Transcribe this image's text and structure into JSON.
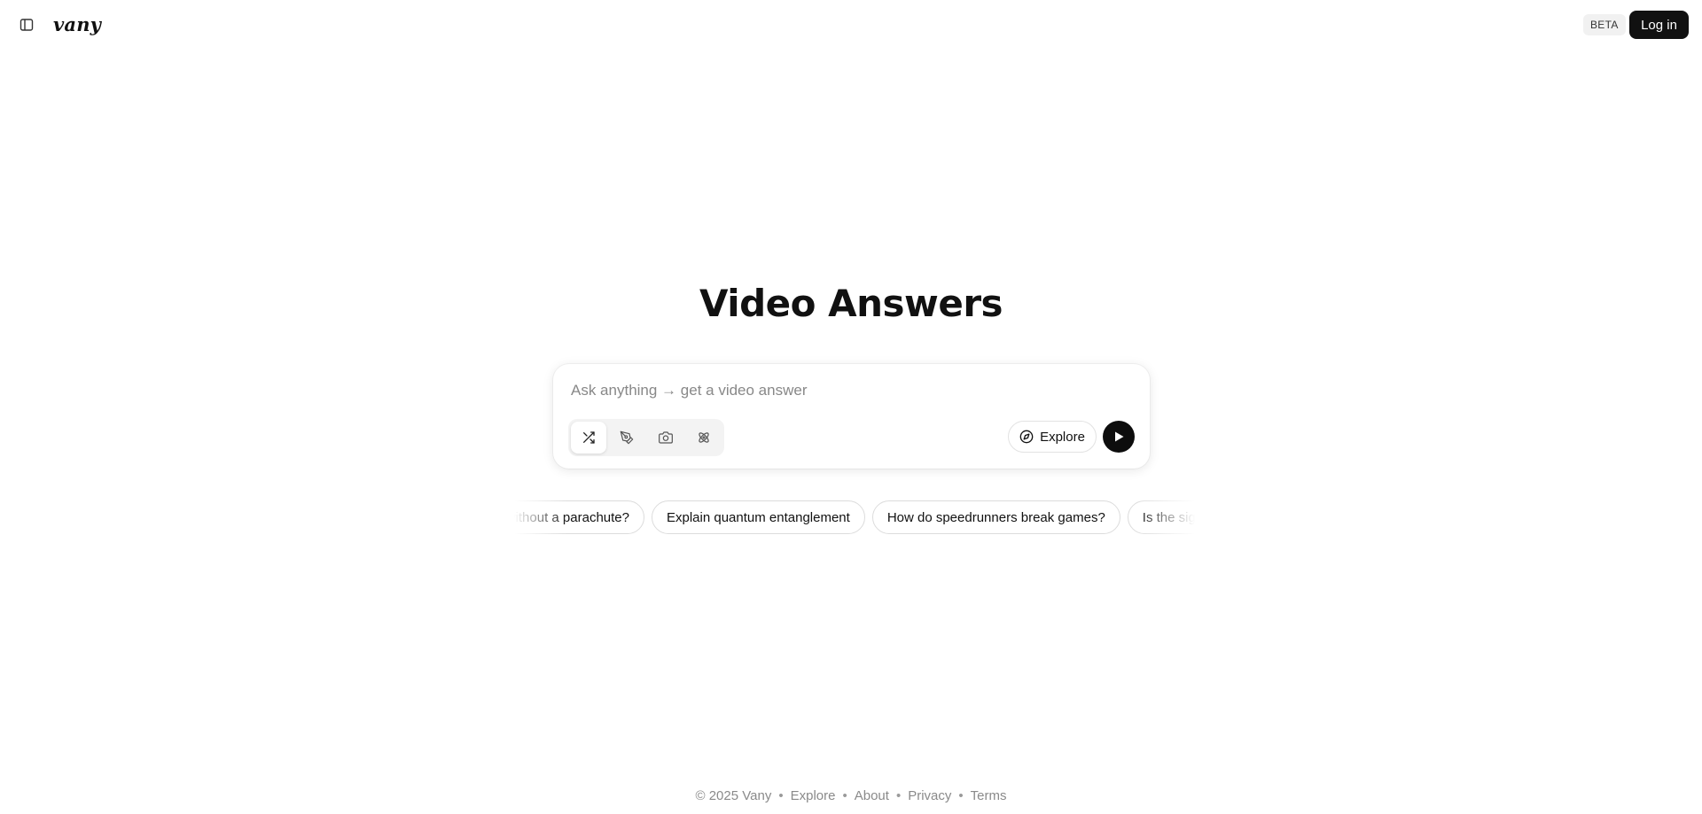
{
  "header": {
    "logo": "vany",
    "beta_badge": "BETA",
    "login_label": "Log in"
  },
  "hero": {
    "title": "Video Answers"
  },
  "composer": {
    "placeholder": "Ask anything → get a video answer",
    "modes": [
      {
        "icon": "shuffle-icon",
        "active": true
      },
      {
        "icon": "pen-tool-icon",
        "active": false
      },
      {
        "icon": "camera-icon",
        "active": false
      },
      {
        "icon": "atom-icon",
        "active": false
      }
    ],
    "explore_label": "Explore",
    "send_icon": "play-icon"
  },
  "suggestions": [
    "How do you survive a fall without a parachute?",
    "Explain quantum entanglement",
    "How do speedrunners break games?",
    "Is the sign"
  ],
  "footer": {
    "copyright": "© 2025 Vany",
    "links": [
      "Explore",
      "About",
      "Privacy",
      "Terms"
    ],
    "separator": "•"
  }
}
